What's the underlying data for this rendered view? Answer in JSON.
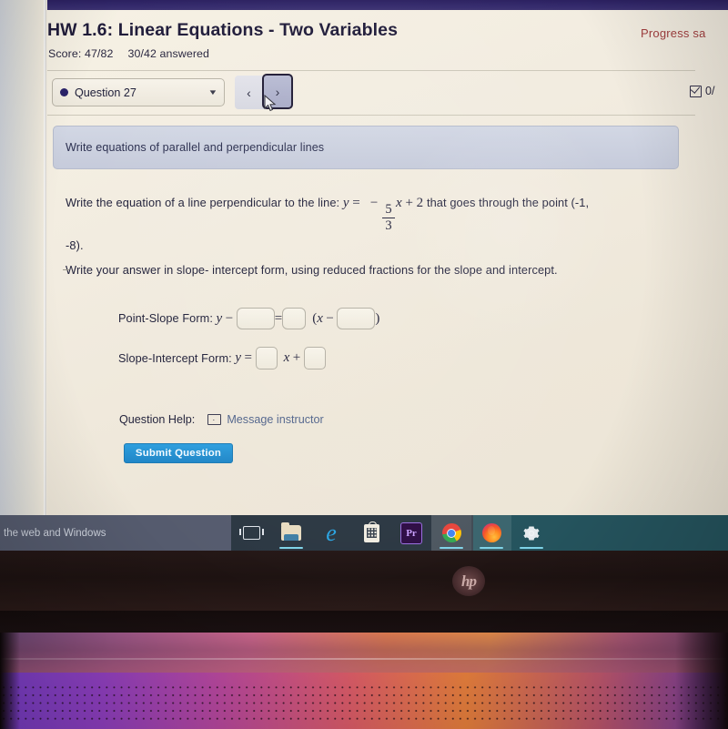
{
  "site": {
    "header_strip_color": "#2b2060"
  },
  "assignment": {
    "title": "HW 1.6: Linear Equations - Two Variables",
    "score_label": "Score: 47/82",
    "answered_label": "30/42 answered",
    "progress_saved": "Progress sa",
    "question_points": "0/"
  },
  "nav": {
    "question_select": "Question 27",
    "caret_icon": "▼",
    "prev_label": "‹",
    "next_label": "›"
  },
  "objective": {
    "text": "Write equations of parallel and perpendicular lines"
  },
  "question": {
    "line1_a": "Write the equation of a line perpendicular to the line:",
    "eq_y": "y",
    "eq_equals": "=",
    "eq_minus": "−",
    "frac_num": "5",
    "frac_den": "3",
    "eq_x": "x",
    "eq_plus": "+",
    "eq_const": "2",
    "line1_b": "that goes through the point (-1,",
    "line2": "-8).",
    "line3": "Write your answer in slope- intercept form, using reduced fractions for the slope and intercept."
  },
  "answers": {
    "point_slope_label": "Point-Slope Form:",
    "ps_y": "y",
    "ps_minus": "−",
    "ps_equals": "=",
    "ps_open": "(",
    "ps_x": "x",
    "ps_x_minus": "−",
    "ps_close": ")",
    "slope_intercept_label": "Slope-Intercept Form:",
    "si_y": "y",
    "si_equals": "=",
    "si_x": "x",
    "si_plus": "+",
    "box_value": ""
  },
  "help": {
    "label": "Question Help:",
    "message_instructor": "Message instructor"
  },
  "submit": {
    "label": "Submit Question"
  },
  "taskbar": {
    "search_text": "the web and Windows",
    "items": [
      {
        "name": "task-view",
        "label": "Task View"
      },
      {
        "name": "file-explorer",
        "label": "File Explorer"
      },
      {
        "name": "microsoft-edge",
        "label": "Microsoft Edge"
      },
      {
        "name": "microsoft-store",
        "label": "Microsoft Store"
      },
      {
        "name": "premiere-pro",
        "label": "Pr"
      },
      {
        "name": "google-chrome",
        "label": "Google Chrome"
      },
      {
        "name": "mozilla-firefox",
        "label": "Firefox"
      },
      {
        "name": "settings",
        "label": "Settings"
      }
    ]
  },
  "laptop": {
    "brand": "hp"
  }
}
